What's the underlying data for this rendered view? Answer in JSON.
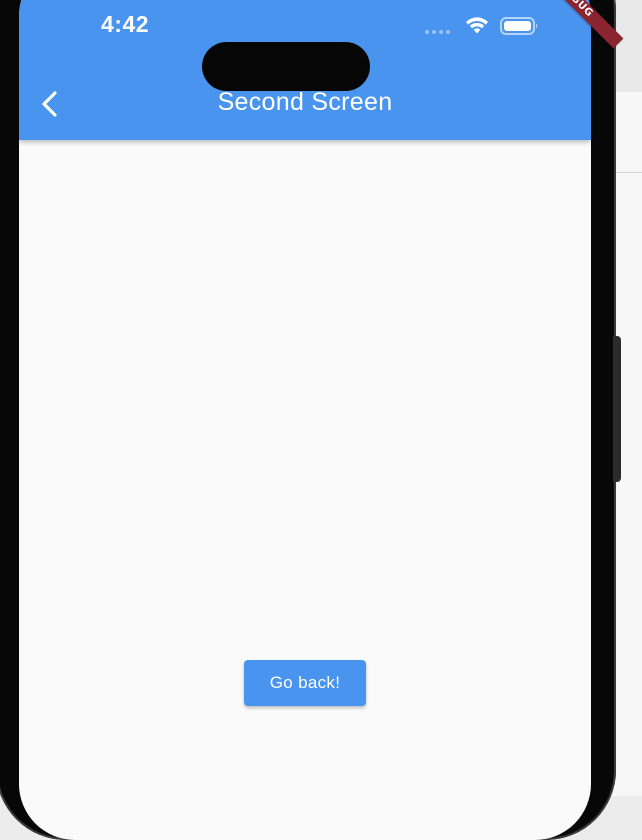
{
  "status_bar": {
    "time": "4:42",
    "wifi_icon": "wifi-icon",
    "battery_icon": "battery-icon"
  },
  "app_bar": {
    "title": "Second Screen",
    "back_icon": "chevron-left-icon",
    "color": "#4894ee"
  },
  "body": {
    "go_back_label": "Go back!"
  },
  "debug_banner": {
    "label": "DEBUG",
    "color": "#8a2530"
  }
}
